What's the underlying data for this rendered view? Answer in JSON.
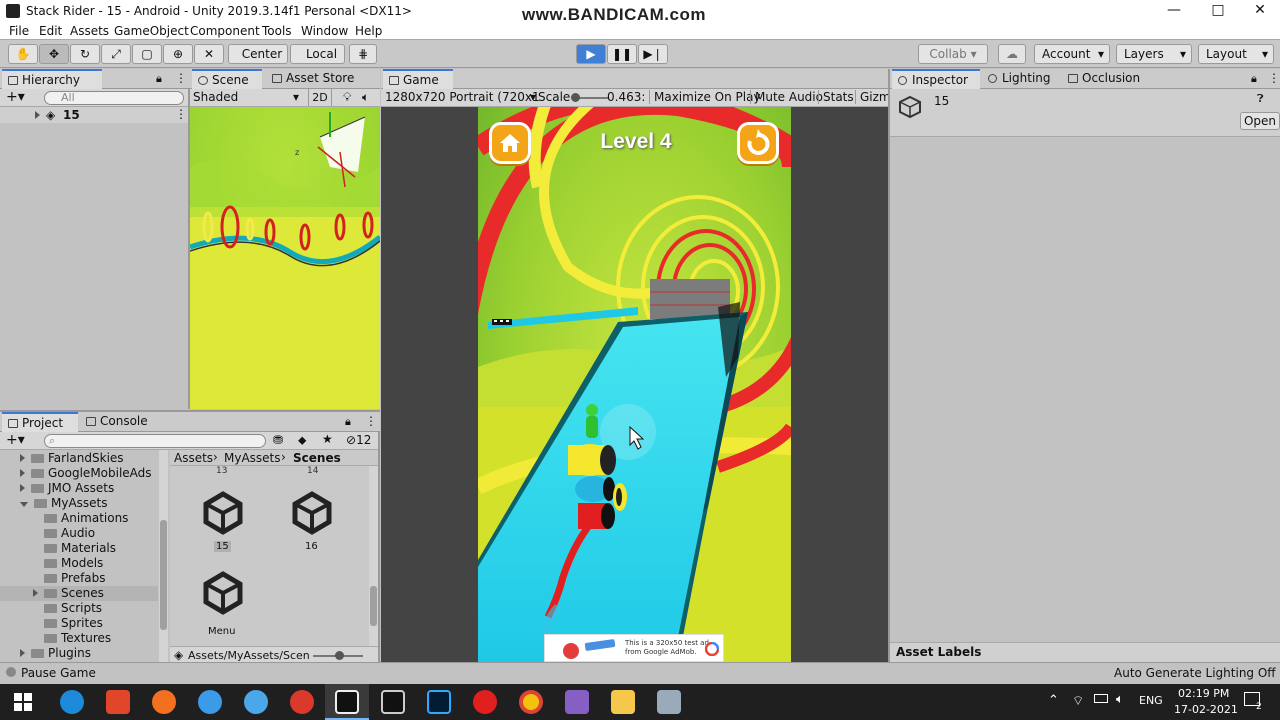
{
  "window": {
    "title": "Stack Rider - 15 - Android - Unity 2019.3.14f1 Personal <DX11>",
    "watermark": "www.BANDICAM.com",
    "minimize": "—",
    "maximize": "□",
    "close": "✕"
  },
  "menu": [
    "File",
    "Edit",
    "Assets",
    "GameObject",
    "Component",
    "Tools",
    "Window",
    "Help"
  ],
  "toolbar": {
    "pivot": "Center",
    "space": "Local",
    "collab": "Collab",
    "account": "Account",
    "layers": "Layers",
    "layout": "Layout"
  },
  "hierarchy": {
    "tab": "Hierarchy",
    "search_placeholder": "All",
    "scene_name": "15"
  },
  "scene": {
    "tab": "Scene",
    "asset_store_tab": "Asset Store",
    "shading": "Shaded",
    "mode_2d": "2D"
  },
  "game": {
    "tab": "Game",
    "resolution": "1280x720 Portrait (720x1",
    "scale_label": "Scale",
    "scale_value": "0.463:",
    "maximize": "Maximize On Play",
    "mute": "Mute Audio",
    "stats": "Stats",
    "gizmos": "Gizm",
    "level_text": "Level 4",
    "ad_text_line1": "This is a 320x50 test ad",
    "ad_text_line2": "from Google AdMob."
  },
  "inspector": {
    "tab": "Inspector",
    "lighting_tab": "Lighting",
    "occlusion_tab": "Occlusion",
    "object_name": "15",
    "open_button": "Open",
    "asset_labels": "Asset Labels"
  },
  "project": {
    "tab": "Project",
    "console_tab": "Console",
    "hidden_count": "12",
    "tree": [
      {
        "label": "FarlandSkies",
        "indent": 0,
        "expanded": false
      },
      {
        "label": "GoogleMobileAds",
        "indent": 0,
        "expanded": false
      },
      {
        "label": "JMO Assets",
        "indent": 0,
        "expanded": false
      },
      {
        "label": "MyAssets",
        "indent": 0,
        "expanded": true
      },
      {
        "label": "Animations",
        "indent": 1,
        "expanded": null
      },
      {
        "label": "Audio",
        "indent": 1,
        "expanded": null
      },
      {
        "label": "Materials",
        "indent": 1,
        "expanded": null
      },
      {
        "label": "Models",
        "indent": 1,
        "expanded": null
      },
      {
        "label": "Prefabs",
        "indent": 1,
        "expanded": null
      },
      {
        "label": "Scenes",
        "indent": 1,
        "expanded": false
      },
      {
        "label": "Scripts",
        "indent": 1,
        "expanded": null
      },
      {
        "label": "Sprites",
        "indent": 1,
        "expanded": null
      },
      {
        "label": "Textures",
        "indent": 1,
        "expanded": null
      },
      {
        "label": "Plugins",
        "indent": 0,
        "expanded": false
      }
    ],
    "breadcrumb": [
      "Assets",
      "MyAssets",
      "Scenes"
    ],
    "partial_labels": [
      "13",
      "14"
    ],
    "assets": [
      "15",
      "16",
      "Menu"
    ],
    "path": "Assets/MyAssets/Scen"
  },
  "status": {
    "left": "Pause Game",
    "right": "Auto Generate Lighting Off"
  },
  "taskbar": {
    "time": "02:19 PM",
    "date": "17-02-2021",
    "lang": "ENG",
    "notifications": "2"
  }
}
